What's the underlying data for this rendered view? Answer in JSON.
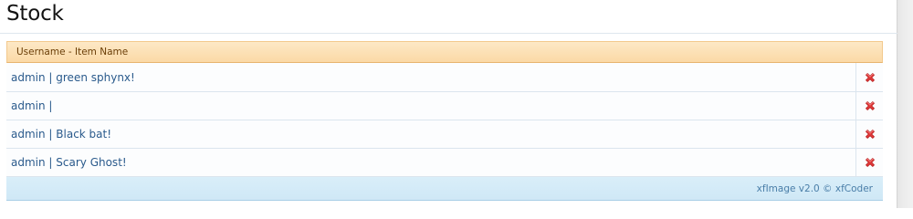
{
  "page": {
    "title": "Stock"
  },
  "table": {
    "header": "Username - Item Name",
    "rows": [
      {
        "label": "admin | green sphynx!",
        "delete_icon": "delete-x-icon"
      },
      {
        "label": "admin |",
        "delete_icon": "delete-x-icon"
      },
      {
        "label": "admin | Black bat!",
        "delete_icon": "delete-x-icon"
      },
      {
        "label": "admin | Scary Ghost!",
        "delete_icon": "delete-x-icon"
      }
    ],
    "footer": "xfImage v2.0 © xfCoder"
  },
  "colors": {
    "header_bg": "#fbd9a6",
    "link": "#2a5a8c",
    "footer_bg": "#d9eef9",
    "delete_icon": "#e33b3b"
  }
}
